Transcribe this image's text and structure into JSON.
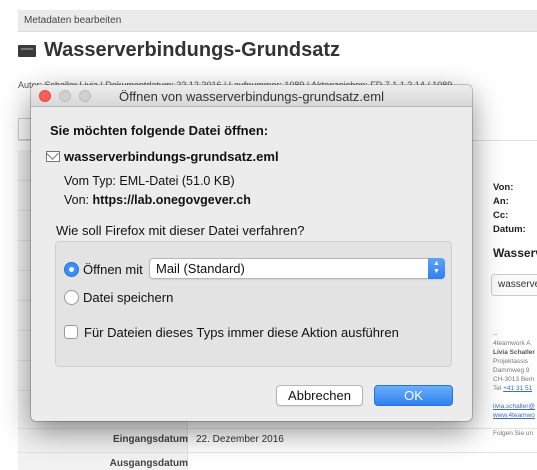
{
  "background_page": {
    "topbar_label": "Metadaten bearbeiten",
    "title": "Wasserverbindungs-Grundsatz",
    "meta_line": "Autor: Schaller Livia | Dokumentdatum: 22.12.2016 | Laufnummer: 1089 | Aktenzeichen: FD 7.1.1.2.14 / 1089",
    "mail_fields": [
      "Von:",
      "An:",
      "Cc:",
      "Datum:"
    ],
    "mail_subject": "Wasserv",
    "attachment_label": "wasserve",
    "signature": {
      "dashes": "--",
      "company": "4teamwork A",
      "person": "Livia Schaller",
      "line1": "Projektassis",
      "line2": "Dammweg 9",
      "line3": "CH-3013 Bern",
      "phone_label": "Tel",
      "phone": "+41 31 51",
      "email": "livia.schaller@",
      "web": "www.4teamwo",
      "follow": "Folgen Sie un"
    },
    "rows": [
      {
        "label": "Eingangsdatum",
        "value": "22. Dezember 2016"
      },
      {
        "label": "Ausgangsdatum",
        "value": ""
      }
    ]
  },
  "dialog": {
    "title": "Öffnen von wasserverbindungs-grundsatz.eml",
    "prompt": "Sie möchten folgende Datei öffnen:",
    "file_name": "wasserverbindungs-grundsatz.eml",
    "type_label": "Vom Typ:",
    "type_value": "EML-Datei (51.0 KB)",
    "from_label": "Von:",
    "from_value": "https://lab.onegovgever.ch",
    "question": "Wie soll Firefox mit dieser Datei verfahren?",
    "open_with_label": "Öffnen mit",
    "open_with_value": "Mail (Standard)",
    "save_label": "Datei speichern",
    "always_label": "Für Dateien dieses Typs immer diese Aktion ausführen",
    "cancel_label": "Abbrechen",
    "ok_label": "OK"
  },
  "icons": {
    "stepper": "updown-chevron-icon",
    "file": "envelope-icon"
  },
  "colors": {
    "accent": "#3b8ef4",
    "close_button": "#fc5f57"
  }
}
